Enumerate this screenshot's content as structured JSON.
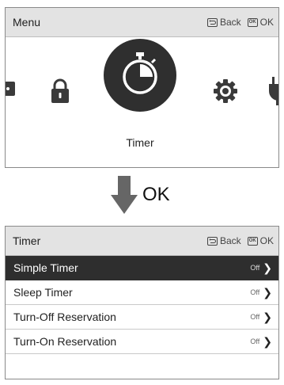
{
  "menu_screen": {
    "title": "Menu",
    "back_label": "Back",
    "ok_label": "OK",
    "back_icon": "return-icon",
    "ok_icon": "ok-icon",
    "ok_icon_text": "OK",
    "items": [
      {
        "icon": "partial-item-icon"
      },
      {
        "icon": "lock-icon"
      },
      {
        "icon": "stopwatch-icon",
        "label": "Timer",
        "selected": true
      },
      {
        "icon": "gear-icon"
      },
      {
        "icon": "plug-icon"
      }
    ]
  },
  "transition": {
    "label": "OK",
    "icon": "down-arrow-icon"
  },
  "timer_screen": {
    "title": "Timer",
    "back_label": "Back",
    "ok_label": "OK",
    "ok_icon_text": "OK",
    "rows": [
      {
        "label": "Simple Timer",
        "status": "Off",
        "selected": true
      },
      {
        "label": "Sleep Timer",
        "status": "Off"
      },
      {
        "label": "Turn-Off Reservation",
        "status": "Off"
      },
      {
        "label": "Turn-On Reservation",
        "status": "Off"
      }
    ]
  },
  "colors": {
    "highlight": "#2e2e2e",
    "header_bg": "#e3e3e3",
    "border": "#8a8a8a"
  }
}
